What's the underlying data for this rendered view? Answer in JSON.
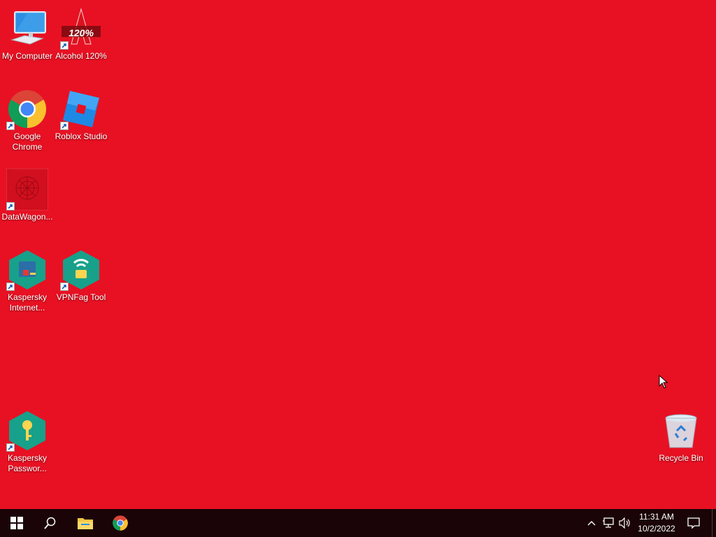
{
  "desktop": {
    "background_color": "#e81123",
    "icons": [
      {
        "label": "My Computer",
        "icon": "computer-icon"
      },
      {
        "label": "Alcohol 120%",
        "icon": "alcohol-120-icon",
        "icon_text": "120%"
      },
      {
        "label": "Google Chrome",
        "icon": "chrome-icon"
      },
      {
        "label": "Roblox Studio",
        "icon": "roblox-studio-icon"
      },
      {
        "label": "DataWagon...",
        "icon": "datawagon-icon"
      },
      {
        "label": "Kaspersky Internet...",
        "icon": "kaspersky-internet-icon"
      },
      {
        "label": "VPNFag Tool",
        "icon": "vpn-tool-icon"
      },
      {
        "label": "Kaspersky Passwor...",
        "icon": "kaspersky-password-icon"
      },
      {
        "label": "Recycle Bin",
        "icon": "recycle-bin-icon"
      }
    ]
  },
  "taskbar": {
    "background_color": "#1b0407",
    "pinned": [
      "start-icon",
      "search-icon",
      "file-explorer-icon",
      "chrome-icon"
    ],
    "tray_icons": [
      "chevron-up-icon",
      "network-icon",
      "volume-icon"
    ],
    "clock": {
      "time": "11:31 AM",
      "date": "10/2/2022"
    },
    "action_center": "notification-icon"
  }
}
